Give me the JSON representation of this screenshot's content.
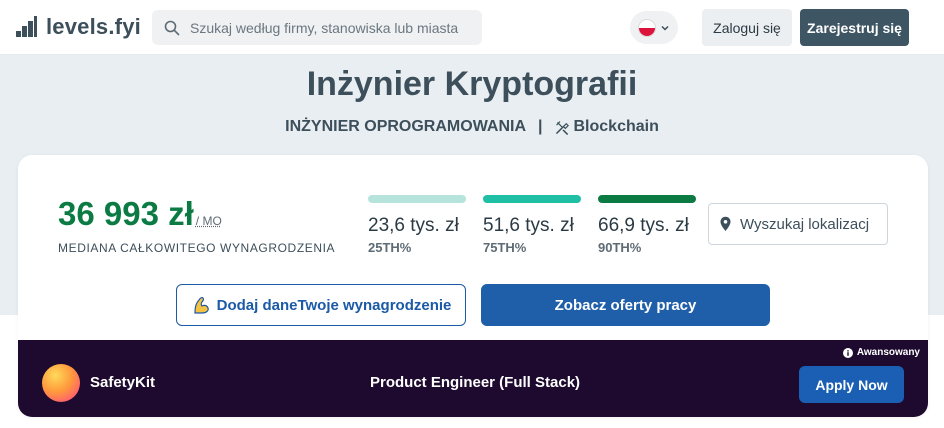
{
  "app": {
    "logo_text": "levels.fyi"
  },
  "search": {
    "placeholder": "Szukaj według firmy, stanowiska lub miasta"
  },
  "header": {
    "language_flag": "poland-flag",
    "login_label": "Zaloguj się",
    "register_label": "Zarejestruj się"
  },
  "page": {
    "title": "Inżynier Kryptografii",
    "category": "INŻYNIER OPROGRAMOWANIA",
    "separator": "|",
    "tag": "Blockchain"
  },
  "salary": {
    "median_value": "36 993 zł",
    "median_period": "/ MO",
    "median_label": "MEDIANA CAŁKOWITEGO WYNAGRODZENIA",
    "percentiles": [
      {
        "value": "23,6 tys. zł",
        "label": "25TH%",
        "color": "#b6e3dc"
      },
      {
        "value": "51,6 tys. zł",
        "label": "75TH%",
        "color": "#1fbfa6"
      },
      {
        "value": "66,9 tys. zł",
        "label": "90TH%",
        "color": "#0b7a43"
      }
    ]
  },
  "location": {
    "placeholder": "Wyszukaj lokalizacj"
  },
  "actions": {
    "add_data_label": "Dodaj daneTwoje wynagrodzenie",
    "see_offers_label": "Zobacz oferty pracy"
  },
  "ad": {
    "badge": "Awansowany",
    "company": "SafetyKit",
    "job_title": "Product Engineer (Full Stack)",
    "apply_label": "Apply Now"
  },
  "colors": {
    "brand_green": "#0b7a43",
    "primary_blue": "#1f5ea8",
    "header_dark": "#3e5563",
    "ad_background": "#1d0a2e"
  }
}
